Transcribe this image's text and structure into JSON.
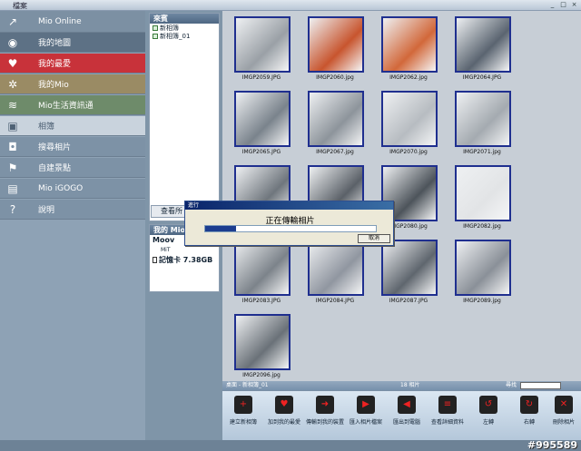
{
  "window": {
    "menu": "檔案",
    "controls": [
      "_",
      "□",
      "×"
    ]
  },
  "sidebar": {
    "items": [
      {
        "label": "Mio Online",
        "icon": "arrow-icon"
      },
      {
        "label": "我的地圖",
        "icon": "eye-icon"
      },
      {
        "label": "我的最愛",
        "icon": "heart-icon"
      },
      {
        "label": "我的Mio",
        "icon": "gear-icon"
      },
      {
        "label": "Mio生活資訊通",
        "icon": "signal-icon"
      },
      {
        "label": "相簿",
        "icon": "photo-icon"
      },
      {
        "label": "搜尋相片",
        "icon": "camera-icon"
      },
      {
        "label": "自建景點",
        "icon": "flag-icon"
      },
      {
        "label": "Mio iGOGO",
        "icon": "book-icon"
      },
      {
        "label": "說明",
        "icon": "help-icon"
      }
    ],
    "active_index": 5
  },
  "tree": {
    "header": "來賓",
    "albums": [
      "新相簿",
      "新相簿_01"
    ],
    "view_all": "查看所"
  },
  "mymio": {
    "header": "我的 Mio",
    "items": [
      "Moov",
      "MiT",
      "記憶卡 7.38GB"
    ]
  },
  "photos": [
    "IMGP2059.JPG",
    "IMGP2060.jpg",
    "IMGP2062.jpg",
    "IMGP2064.JPG",
    "IMGP2065.JPG",
    "IMGP2067.jpg",
    "IMGP2070.jpg",
    "IMGP2071.jpg",
    "IMGP2078.jpg",
    "IMGP2079.jpg",
    "IMGP2080.jpg",
    "IMGP2082.jpg",
    "IMGP2083.JPG",
    "IMGP2084.JPG",
    "IMGP2087.JPG",
    "IMGP2089.jpg",
    "IMGP2096.jpg"
  ],
  "dialog": {
    "title": "進行",
    "message": "正在傳輸相片",
    "progress_percent": 18,
    "cancel_label": "取消"
  },
  "statusbar": {
    "breadcrumb": "桌面 - 新相簿_01",
    "count": "18 相片",
    "find_label": "尋找"
  },
  "toolbar": {
    "buttons": [
      {
        "label": "建立新相簿"
      },
      {
        "label": "加到我的最愛"
      },
      {
        "label": "傳輸到我的裝置"
      },
      {
        "label": "匯入相片檔案"
      },
      {
        "label": "匯出到電腦"
      },
      {
        "label": "查看詳細資料"
      },
      {
        "label": "左轉"
      },
      {
        "label": "右轉"
      },
      {
        "label": "刪除相片"
      }
    ]
  },
  "watermark": "#995589"
}
